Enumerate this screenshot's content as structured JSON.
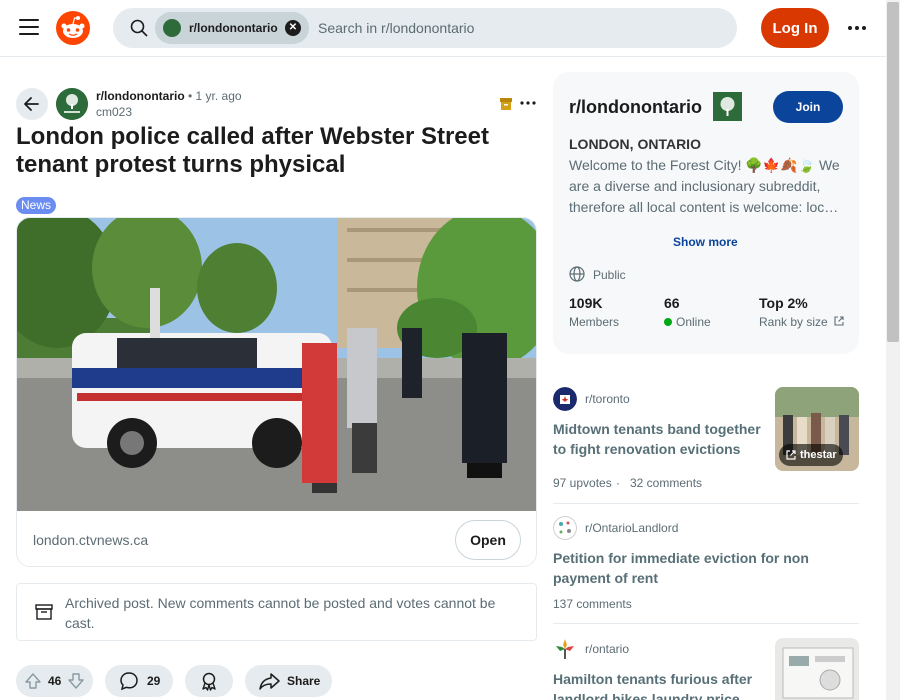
{
  "header": {
    "search_chip": "r/londonontario",
    "search_placeholder": "Search in r/londonontario",
    "login_label": "Log In"
  },
  "post": {
    "subreddit": "r/londonontario",
    "time": "• 1 yr. ago",
    "author": "cm023",
    "title": "London police called after Webster Street tenant protest turns physical",
    "flair": "News",
    "link_domain": "london.ctvnews.ca",
    "open_label": "Open",
    "archived_notice": "Archived post. New comments cannot be posted and votes cannot be cast.",
    "votes": "46",
    "comments": "29",
    "share_label": "Share"
  },
  "sidebar": {
    "name": "r/londonontario",
    "join_label": "Join",
    "heading": "LONDON, ONTARIO",
    "description": "Welcome to the Forest City! 🌳🍁🍂🍃 We are a diverse and inclusionary subreddit, therefore all local content is welcome: loc…",
    "show_more": "Show more",
    "visibility": "Public",
    "members_value": "109K",
    "members_label": "Members",
    "online_value": "66",
    "online_label": "Online",
    "rank_value": "Top 2%",
    "rank_label": "Rank by size"
  },
  "related": [
    {
      "subreddit": "r/toronto",
      "title": "Midtown tenants band together to fight renovation evictions",
      "upvotes": "97 upvotes",
      "comments": "32 comments",
      "thumb_label": "thestar"
    },
    {
      "subreddit": "r/OntarioLandlord",
      "title": "Petition for immediate eviction for non payment of rent",
      "comments": "137 comments"
    },
    {
      "subreddit": "r/ontario",
      "title": "Hamilton tenants furious after landlord hikes laundry price t…"
    }
  ],
  "colors": {
    "brand": "#d93900",
    "join": "#0a449b",
    "flair": "#6b8cf0",
    "online": "#01a816"
  }
}
